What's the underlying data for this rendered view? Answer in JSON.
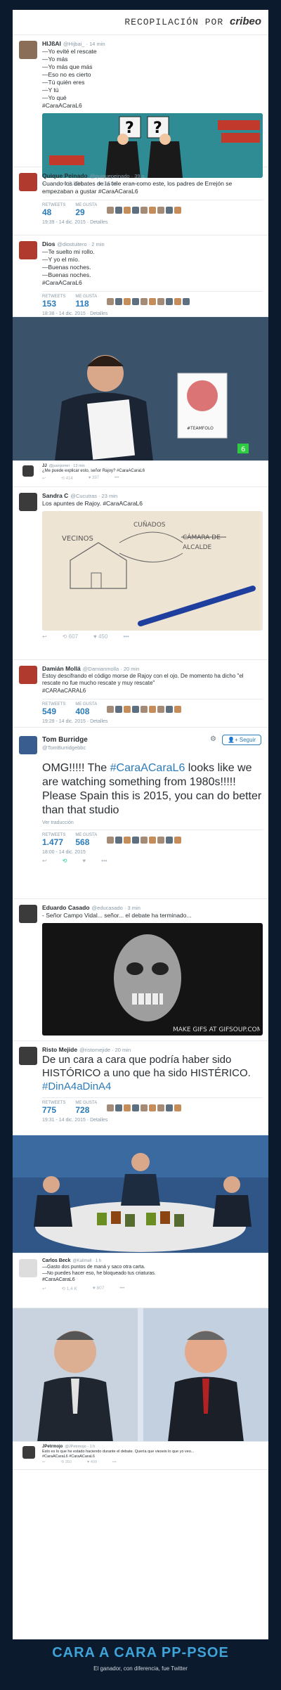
{
  "header": {
    "title_prefix": "RECOPILACIÓN POR",
    "brand": "cribeo"
  },
  "tweets": [
    {
      "name": "HIJßAI",
      "handle": "@Hijbai_ · 14 min",
      "text": "—Yo evité el rescate\n—Yo más\n—Yo más que más\n—Eso no es cierto\n—Tú quién eres\n—Y tú\n—Yo qué\n#CaraACaraL6",
      "actions": [
        "↩",
        "⟲ 2.834",
        "♥ 1.504",
        "•••"
      ]
    },
    {
      "name": "Quique Peinado",
      "handle": "@quiquepeinado · 39 s",
      "text": "Cuando los debates de la tele eran como este, los padres de Errejón se empezaban a gustar #CaraACaraL6",
      "retweets_label": "RETWEETS",
      "retweets": "48",
      "likes_label": "ME GUSTA",
      "likes": "29",
      "date": "19:39 - 14 dic. 2015 · Detalles"
    },
    {
      "name": "Dios",
      "handle": "@diostuitero · 2 min",
      "text": "—Te suelto mi rollo.\n—Y yo el mío.\n—Buenas noches.\n—Buenas noches.\n#CaraACaraL6",
      "retweets_label": "RETWEETS",
      "retweets": "153",
      "likes_label": "ME GUSTA",
      "likes": "118",
      "date": "18:38 - 14 dic. 2015 · Detalles"
    },
    {
      "name": "JJ",
      "handle": "@juanjomer · 13 min",
      "text": "¿Me puede explicar esto, señor Rajoy? #CaraACaraL6",
      "actions": [
        "↩",
        "⟲ 414",
        "♥ 397",
        "•••"
      ]
    },
    {
      "name": "Sandra C",
      "handle": "@Cucutras · 23 min",
      "text": "Los apuntes de Rajoy. #CaraACaraL6",
      "actions": [
        "↩",
        "⟲ 607",
        "♥ 450",
        "•••"
      ]
    },
    {
      "name": "Damián Mollá",
      "handle": "@Damianmolla · 20 min",
      "text": "Estoy descifrando el código morse de Rajoy con el ojo. De momento ha dicho \"el rescate no fue mucho rescate y muy rescate\"\n#CARAaCARAL6",
      "retweets_label": "RETWEETS",
      "retweets": "549",
      "likes_label": "ME GUSTA",
      "likes": "408",
      "date": "19:29 - 14 dic. 2015 · Detalles"
    },
    {
      "name": "Tom Burridge",
      "handle": "@TomBurridgebbc",
      "follow": "Seguir",
      "text": "OMG!!!!! The #CaraACaraL6 looks like we are watching something from 1980s!!!!! Please Spain this is 2015, you can do better than that studio",
      "translate": "Ver traducción",
      "retweets_label": "RETWEETS",
      "retweets": "1.477",
      "likes_label": "ME GUSTA",
      "likes": "568",
      "date": "18:00 - 14 dic. 2015"
    },
    {
      "name": "Eduardo Casado",
      "handle": "@educasado · 3 min",
      "text": "- Señor Campo Vidal... señor... el debate ha terminado...",
      "gif": "MAKE GIFS AT GIFSOUP.COM"
    },
    {
      "name": "Risto Mejide",
      "handle": "@ristomejide · 20 min",
      "text": "De un cara a cara que podría haber sido HISTÓRICO a uno que ha sido HISTÉRICO. #DinA4aDinA4",
      "retweets_label": "RETWEETS",
      "retweets": "775",
      "likes_label": "ME GUSTA",
      "likes": "728",
      "date": "19:31 - 14 dic. 2015 · Detalles"
    },
    {
      "name": "Carlos Beck",
      "handle": "@Kallmell · 1 h",
      "text": "—Gasto dos puntos de maná y saco otra carta.\n—No puedes hacer eso, he bloqueado tus criaturas.\n#CaraACaraL6",
      "actions": [
        "↩",
        "⟲ 1,4 K",
        "♥ 807",
        "•••"
      ]
    },
    {
      "name": "JPetrmojo",
      "handle": "@JPetrmojo · 1 h",
      "text": "Esto es lo que he estado haciendo durante el debate. Quería que vieseis lo que yo veo...\n#CaraACaraL6 #CaraACaraL6",
      "actions": [
        "↩",
        "⟲ 350",
        "♥ 409",
        "•••"
      ]
    }
  ],
  "sketch": {
    "vecinos": "VECINOS",
    "cuñados": "CUÑADOS",
    "camara": "CÁMARA DE",
    "alcalde": "ALCALDE"
  },
  "badge": "#TEAMFOLO",
  "footer": {
    "title": "CARA A CARA PP-PSOE",
    "subtitle": "El ganador, con diferencia, fue Twitter"
  }
}
